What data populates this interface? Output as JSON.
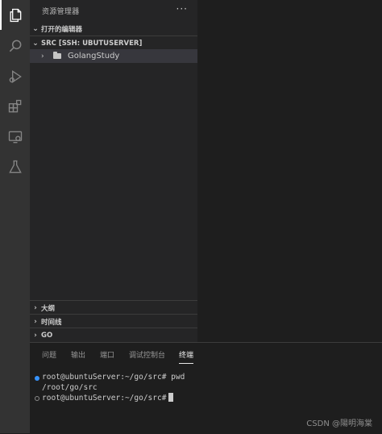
{
  "activity_bar": {
    "icons": [
      "explorer-icon",
      "search-icon",
      "run-debug-icon",
      "extensions-icon",
      "remote-explorer-icon",
      "testing-icon"
    ]
  },
  "sidebar": {
    "title": "资源管理器",
    "more": "···",
    "sections": {
      "open_editors": "打开的编辑器",
      "src": "SRC [SSH: UBUTUSERVER]",
      "outline": "大纲",
      "timeline": "时间线",
      "go": "GO"
    },
    "tree": {
      "folder": "GolangStudy"
    }
  },
  "panel": {
    "tabs": [
      "问题",
      "输出",
      "端口",
      "调试控制台",
      "终端"
    ],
    "active_tab": "终端",
    "terminal": {
      "line1": "root@ubuntuServer:~/go/src# pwd",
      "line2": "/root/go/src",
      "line3": "root@ubuntuServer:~/go/src#"
    }
  },
  "watermark": "CSDN @陽明海棠",
  "colors": {
    "accent": "#3794ff",
    "sidebar_bg": "#252526",
    "activity_bg": "#333333",
    "editor_bg": "#1e1e1e"
  }
}
